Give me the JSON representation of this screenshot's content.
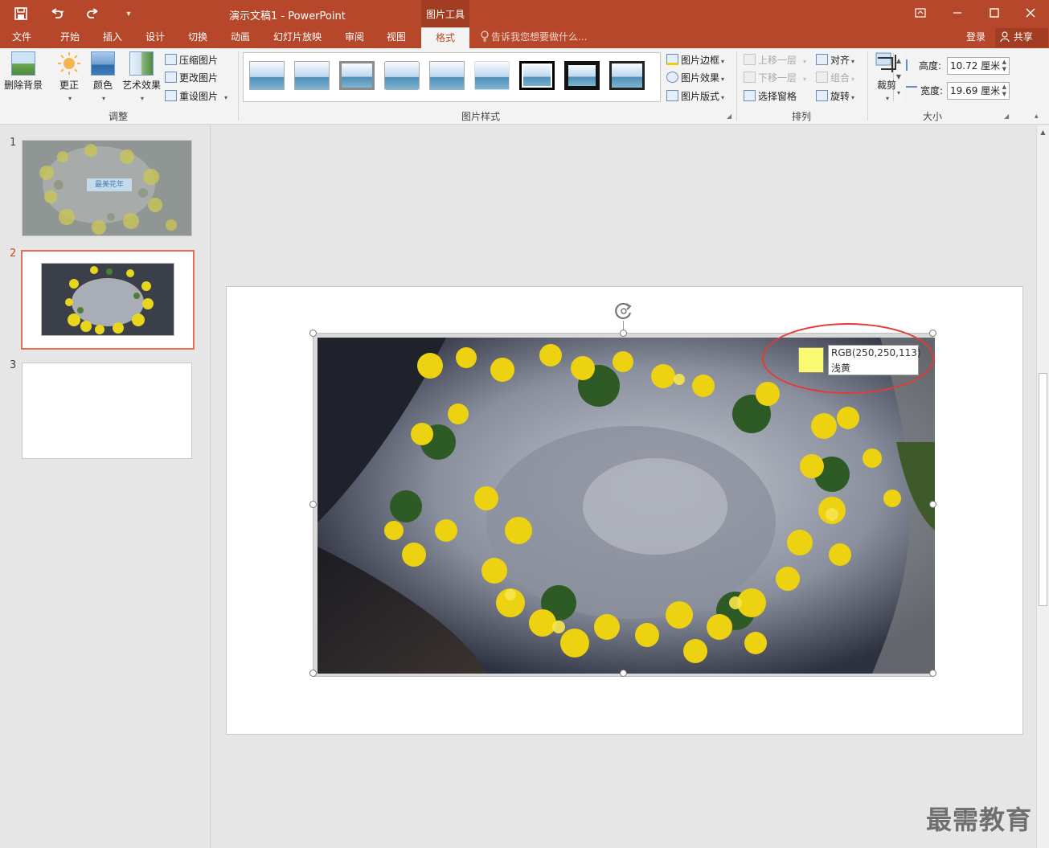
{
  "window": {
    "title": "演示文稿1 - PowerPoint",
    "context_tab_group": "图片工具"
  },
  "qat": {
    "save_icon": "save-icon",
    "undo_icon": "undo-icon",
    "redo_icon": "redo-icon",
    "customize_icon": "customize-icon"
  },
  "tabs": [
    {
      "label": "文件"
    },
    {
      "label": "开始"
    },
    {
      "label": "插入"
    },
    {
      "label": "设计"
    },
    {
      "label": "切换"
    },
    {
      "label": "动画"
    },
    {
      "label": "幻灯片放映"
    },
    {
      "label": "审阅"
    },
    {
      "label": "视图"
    },
    {
      "label": "格式"
    }
  ],
  "tell_me": "告诉我您想要做什么...",
  "account": {
    "signin": "登录",
    "share": "共享"
  },
  "ribbon": {
    "adjust": {
      "label": "调整",
      "remove_bg": "删除背景",
      "corrections": "更正",
      "color": "颜色",
      "artistic": "艺术效果",
      "compress": "压缩图片",
      "change": "更改图片",
      "reset": "重设图片"
    },
    "styles": {
      "label": "图片样式",
      "border": "图片边框",
      "effects": "图片效果",
      "layout": "图片版式"
    },
    "arrange": {
      "label": "排列",
      "bring_forward": "上移一层",
      "send_backward": "下移一层",
      "selection_pane": "选择窗格",
      "align": "对齐",
      "group": "组合",
      "rotate": "旋转"
    },
    "size": {
      "label": "大小",
      "crop": "裁剪",
      "height_label": "高度:",
      "height_value": "10.72 厘米",
      "width_label": "宽度:",
      "width_value": "19.69 厘米"
    }
  },
  "slides": [
    {
      "number": "1",
      "caption": "最美花年"
    },
    {
      "number": "2"
    },
    {
      "number": "3"
    }
  ],
  "tooltip": {
    "rgb": "RGB(250,250,113)",
    "name": "浅黄",
    "swatch_color": "#fafa71"
  },
  "watermark": "最需教育",
  "colors": {
    "accent": "#b7472a",
    "active_tab_text": "#b7472a",
    "selection_frame": "#e4704d",
    "highlight_circle": "#e23b34"
  }
}
